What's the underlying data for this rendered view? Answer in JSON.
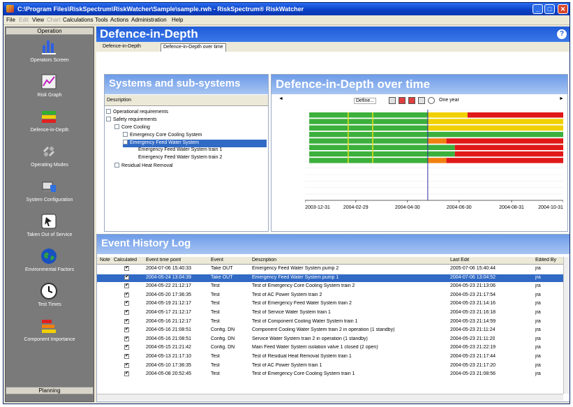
{
  "window": {
    "title": "C:\\Program Files\\RiskSpectrum\\RiskWatcher\\Sample\\sample.rwh - RiskSpectrum® RiskWatcher"
  },
  "menu": [
    {
      "label": "File",
      "enabled": true
    },
    {
      "label": "Edit",
      "enabled": false
    },
    {
      "label": "View",
      "enabled": true
    },
    {
      "label": "Chart",
      "enabled": false
    },
    {
      "label": "Calculations",
      "enabled": true
    },
    {
      "label": "Tools",
      "enabled": true
    },
    {
      "label": "Actions",
      "enabled": true
    },
    {
      "label": "Administration",
      "enabled": true
    },
    {
      "label": "Help",
      "enabled": true
    }
  ],
  "sidebar": {
    "top_label": "Operation",
    "bottom_label": "Planning",
    "items": [
      {
        "label": "Operators Screen",
        "icon": "bar-chart-icon"
      },
      {
        "label": "Risk Graph",
        "icon": "risk-graph-icon"
      },
      {
        "label": "Defence-in-Depth",
        "icon": "defence-stack-icon"
      },
      {
        "label": "Operating Modes",
        "icon": "operating-modes-icon"
      },
      {
        "label": "System Configuration",
        "icon": "system-configuration-icon"
      },
      {
        "label": "Taken Out of Service",
        "icon": "taken-out-icon"
      },
      {
        "label": "Environmental Factors",
        "icon": "globe-icon"
      },
      {
        "label": "Test Times",
        "icon": "clock-icon"
      },
      {
        "label": "Component Importance",
        "icon": "component-importance-icon"
      }
    ]
  },
  "header": {
    "title": "Defence-in-Depth"
  },
  "tabs": [
    "Defence-in-Depth",
    "Defence-in-Depth over time"
  ],
  "systems": {
    "title": "Systems and sub-systems",
    "column": "Description",
    "tree": [
      {
        "label": "Operational requirements",
        "level": 0,
        "toggle": "+",
        "selected": false
      },
      {
        "label": "Safety requirements",
        "level": 0,
        "toggle": "-",
        "selected": false
      },
      {
        "label": "Core Cooling",
        "level": 1,
        "toggle": "-",
        "selected": false
      },
      {
        "label": "Emergency Core Cooling System",
        "level": 2,
        "toggle": "+",
        "selected": false
      },
      {
        "label": "Emergency Feed Water System",
        "level": 2,
        "toggle": "-",
        "selected": true
      },
      {
        "label": "Emergency Feed Water System train 1",
        "level": 3,
        "toggle": "",
        "selected": false
      },
      {
        "label": "Emergency Feed Water System train 2",
        "level": 3,
        "toggle": "",
        "selected": false
      },
      {
        "label": "Residual Heat Removal",
        "level": 1,
        "toggle": "+",
        "selected": false
      }
    ]
  },
  "timeline": {
    "title": "Defence-in-Depth over time",
    "define_label": "Define...",
    "period_label": "One year",
    "icons": [
      "calendar-icon",
      "calendar-red-icon",
      "calendar-red-icon",
      "calendar-icon",
      "clock-icon"
    ]
  },
  "chart_data": {
    "type": "gantt",
    "x_range": [
      "2003-12-31",
      "2004-10-31"
    ],
    "x_ticks": [
      "2003-12-31",
      "2004-02-29",
      "2004-04-30",
      "2004-06-30",
      "2004-08-31",
      "2004-10-31"
    ],
    "current_date": "2004-05-24",
    "colors": {
      "green": "#3cb03c",
      "yellow": "#f0d000",
      "orange": "#f08010",
      "red": "#e01818"
    },
    "rows": [
      {
        "segments": [
          {
            "from": "2004-01-05",
            "to": "2004-05-24",
            "state": "green"
          },
          {
            "from": "2004-05-24",
            "to": "2004-07-10",
            "state": "yellow"
          },
          {
            "from": "2004-07-10",
            "to": "2004-10-31",
            "state": "red"
          }
        ]
      },
      {
        "segments": [
          {
            "from": "2004-01-05",
            "to": "2004-05-24",
            "state": "green"
          },
          {
            "from": "2004-05-24",
            "to": "2004-10-31",
            "state": "yellow"
          }
        ]
      },
      {
        "segments": [
          {
            "from": "2004-01-05",
            "to": "2004-05-24",
            "state": "green"
          },
          {
            "from": "2004-05-24",
            "to": "2004-10-31",
            "state": "yellow"
          }
        ]
      },
      {
        "segments": [
          {
            "from": "2004-01-05",
            "to": "2004-10-31",
            "state": "green"
          }
        ]
      },
      {
        "segments": [
          {
            "from": "2004-01-05",
            "to": "2004-05-24",
            "state": "green"
          },
          {
            "from": "2004-05-24",
            "to": "2004-06-15",
            "state": "orange"
          },
          {
            "from": "2004-06-15",
            "to": "2004-10-31",
            "state": "red"
          }
        ]
      },
      {
        "segments": [
          {
            "from": "2004-01-05",
            "to": "2004-06-25",
            "state": "green"
          },
          {
            "from": "2004-06-25",
            "to": "2004-10-31",
            "state": "red"
          }
        ]
      },
      {
        "segments": [
          {
            "from": "2004-01-05",
            "to": "2004-06-25",
            "state": "green"
          },
          {
            "from": "2004-06-25",
            "to": "2004-10-31",
            "state": "red"
          }
        ]
      },
      {
        "segments": [
          {
            "from": "2004-01-05",
            "to": "2004-05-24",
            "state": "green"
          },
          {
            "from": "2004-05-24",
            "to": "2004-06-15",
            "state": "orange"
          },
          {
            "from": "2004-06-15",
            "to": "2004-10-31",
            "state": "red"
          }
        ]
      }
    ],
    "yellow_markers": [
      "2004-02-20",
      "2004-03-20"
    ]
  },
  "event_log": {
    "title": "Event History Log",
    "columns": [
      "Note",
      "Calculated",
      "Event time point",
      "Event",
      "Description",
      "Last Edit",
      "Edited By"
    ],
    "rows": [
      {
        "calc": true,
        "time": "2004-07-06 15:40:33",
        "event": "Take OUT",
        "desc": "Emergency Feed Water System pump 2",
        "edit": "2005-07-06 15:40:44",
        "by": "jra",
        "selected": false
      },
      {
        "calc": true,
        "time": "2004-05-24 13:04:39",
        "event": "Take OUT",
        "desc": "Emergency Feed Water System pump 1",
        "edit": "2004-07-06 13:04:52",
        "by": "jra",
        "selected": true
      },
      {
        "calc": true,
        "time": "2004-05-22 21:12:17",
        "event": "Test",
        "desc": "Test of Emergency Core Cooling System train 2",
        "edit": "2004-05-23 21:13:06",
        "by": "jra",
        "selected": false
      },
      {
        "calc": true,
        "time": "2004-05-20 17:36:35",
        "event": "Test",
        "desc": "Test of AC Power System train 2",
        "edit": "2004-05-23 21:17:54",
        "by": "jra",
        "selected": false
      },
      {
        "calc": true,
        "time": "2004-05-19 21:12:17",
        "event": "Test",
        "desc": "Test of Emergency Feed Water System train 2",
        "edit": "2004-05-23 21:14:16",
        "by": "jra",
        "selected": false
      },
      {
        "calc": true,
        "time": "2004-05-17 21:12:17",
        "event": "Test",
        "desc": "Test of Service Water System train 1",
        "edit": "2004-05-23 21:16:18",
        "by": "jra",
        "selected": false
      },
      {
        "calc": true,
        "time": "2004-05-16 21:12:17",
        "event": "Test",
        "desc": "Test of Component Cooling Water System train 1",
        "edit": "2004-05-23 21:14:59",
        "by": "jra",
        "selected": false
      },
      {
        "calc": true,
        "time": "2004-05-16 21:08:51",
        "event": "Config. DN",
        "desc": "Component Cooling Water System train 2 in operation (1 standby)",
        "edit": "2004-05-23 21:11:24",
        "by": "jra",
        "selected": false
      },
      {
        "calc": true,
        "time": "2004-05-16 21:08:51",
        "event": "Config. DN",
        "desc": "Service Water System train 2 in operation (1 standby)",
        "edit": "2004-05-23 21:11:20",
        "by": "jra",
        "selected": false
      },
      {
        "calc": true,
        "time": "2004-05-15 21:21:42",
        "event": "Config. DN",
        "desc": "Main Feed Water System isolation valve 1 closed (2 open)",
        "edit": "2004-05-23 21:22:19",
        "by": "jra",
        "selected": false
      },
      {
        "calc": true,
        "time": "2004-05-13 21:17:10",
        "event": "Test",
        "desc": "Test of Residual Heat Removal System train 1",
        "edit": "2004-05-23 21:17:44",
        "by": "jra",
        "selected": false
      },
      {
        "calc": true,
        "time": "2004-05-10 17:36:35",
        "event": "Test",
        "desc": "Test of AC Power System train 1",
        "edit": "2004-05-23 21:17:20",
        "by": "jra",
        "selected": false
      },
      {
        "calc": true,
        "time": "2004-05-08 20:52:45",
        "event": "Test",
        "desc": "Test of Emergency Core Cooling System train 1",
        "edit": "2004-05-23 21:08:56",
        "by": "jra",
        "selected": false
      }
    ]
  }
}
